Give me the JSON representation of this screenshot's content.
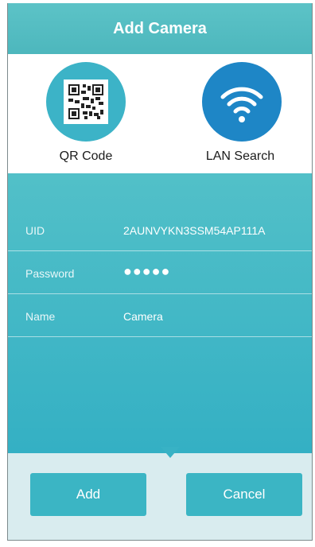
{
  "header": {
    "title": "Add Camera"
  },
  "add_methods": [
    {
      "label": "QR Code",
      "icon": "qr-code-icon",
      "color": "#3cb3c7"
    },
    {
      "label": "LAN Search",
      "icon": "wifi-icon",
      "color": "#1e86c6"
    }
  ],
  "form": {
    "uid": {
      "label": "UID",
      "value": "2AUNVYKN3SSM54AP111A"
    },
    "password": {
      "label": "Password",
      "value": "●●●●●"
    },
    "name": {
      "label": "Name",
      "value": "Camera"
    }
  },
  "actions": {
    "add_label": "Add",
    "cancel_label": "Cancel"
  },
  "colors": {
    "accent": "#3bb5c4",
    "lan_blue": "#1e86c6",
    "panel_bg": "#d9ecef"
  }
}
